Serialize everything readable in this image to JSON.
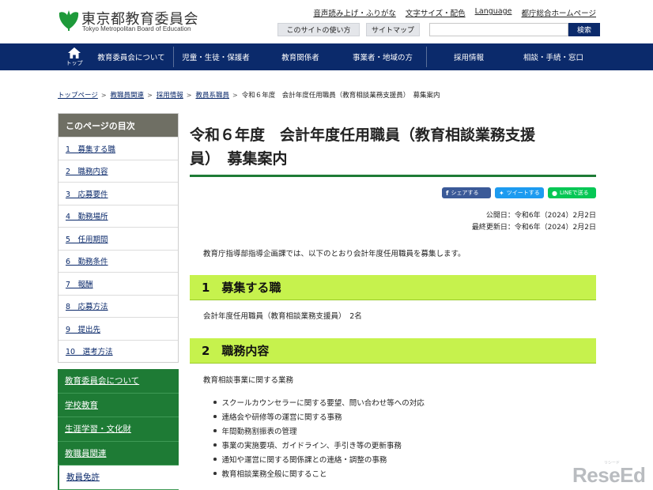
{
  "header": {
    "logo_ja": "東京都教育委員会",
    "logo_en": "Tokyo Metropolitan Board of Education",
    "util_links": [
      "音声読み上げ・ふりがな",
      "文字サイズ・配色",
      "Language",
      "都庁総合ホームページ"
    ],
    "guide_button": "このサイトの使い方",
    "sitemap_button": "サイトマップ",
    "search_placeholder": "",
    "search_button": "検索"
  },
  "gnav": {
    "home_label": "トップ",
    "items": [
      "教育委員会について",
      "児童・生徒・保護者",
      "教育関係者",
      "事業者・地域の方",
      "採用情報",
      "相談・手続・窓口"
    ]
  },
  "breadcrumb": {
    "links": [
      "トップページ",
      "教職員関連",
      "採用情報",
      "教員系職員"
    ],
    "current": "令和６年度　会計年度任用職員（教育相談業務支援員）　募集案内"
  },
  "toc": {
    "title": "このページの目次",
    "items": [
      "1　募集する職",
      "2　職務内容",
      "3　応募要件",
      "4　勤務場所",
      "5　任用期間",
      "6　勤務条件",
      "7　報酬",
      "8　応募方法",
      "9　提出先",
      "10　選考方法"
    ]
  },
  "side_nav": {
    "items": [
      "教育委員会について",
      "学校教育",
      "生涯学習・文化財",
      "教職員関連",
      "教員免許"
    ]
  },
  "main": {
    "title_line1": "令和６年度　会計年度任用職員（教育相談業務支援",
    "title_line2": "員）　募集案内",
    "share": {
      "facebook": "シェアする",
      "twitter": "ツイートする",
      "line": "LINEで送る"
    },
    "published": "公開日：令和6年（2024）2月2日",
    "updated": "最終更新日：令和6年（2024）2月2日",
    "lead": "教育庁指導部指導企画課では、以下のとおり会計年度任用職員を募集します。",
    "section1_heading": "1　募集する職",
    "section1_text": "会計年度任用職員（教育相談業務支援員）　2名",
    "section2_heading": "2　職務内容",
    "section2_intro": "教育相談事業に関する業務",
    "duties": [
      "スクールカウンセラーに関する要望、問い合わせ等への対応",
      "連絡会や研修等の運営に関する事務",
      "年間勤務割振表の管理",
      "事業の実施要項、ガイドライン、手引き等の更新事務",
      "通知や運営に関する関係課との連絡・調整の事務",
      "教育相談業務全般に関すること"
    ]
  },
  "watermark": {
    "text": "ReseEd",
    "ruby": "リシード"
  },
  "colors": {
    "navy": "#0b2a6b",
    "green": "#1e7b35",
    "section_bg": "#c6f24d",
    "toc_head": "#6f6f64"
  }
}
